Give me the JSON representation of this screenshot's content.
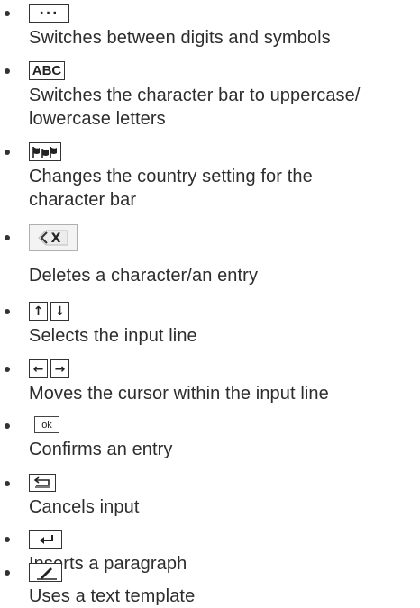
{
  "items": [
    {
      "key_icon": "ellipsis-key-icon",
      "key_label": "···",
      "description": "Switches between digits and symbols"
    },
    {
      "key_icon": "abc-key-icon",
      "key_label": "ABC",
      "description": "Switches the character bar to uppercase/ lowercase letters"
    },
    {
      "key_icon": "flags-key-icon",
      "description": "Changes the country setting for the character bar"
    },
    {
      "key_icon": "delete-key-icon",
      "description": "Deletes a character/an entry"
    },
    {
      "key_icon": "up-down-arrow-keys-icon",
      "description": "Selects the input line"
    },
    {
      "key_icon": "left-right-arrow-keys-icon",
      "description": "Moves the cursor within the input line"
    },
    {
      "key_icon": "ok-key-icon",
      "key_label": "ok",
      "description": "Confirms an entry"
    },
    {
      "key_icon": "back-key-icon",
      "description": "Cancels input"
    },
    {
      "key_icon": "enter-key-icon",
      "description": "Inserts a paragraph"
    },
    {
      "key_icon": "pen-key-icon",
      "description": "Uses a text template"
    }
  ]
}
